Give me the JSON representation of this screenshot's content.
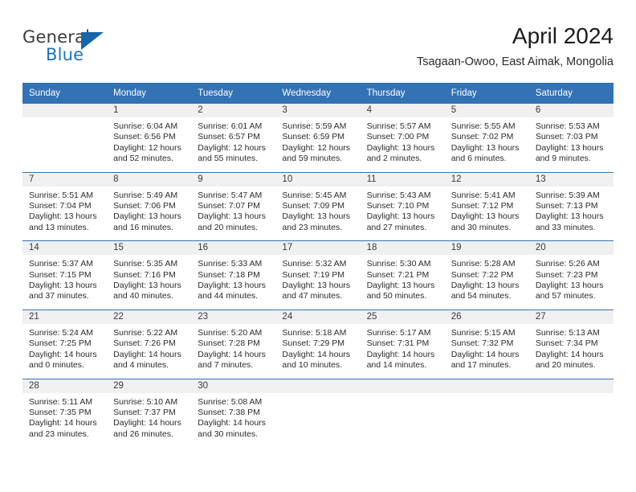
{
  "brand": {
    "name_part1": "General",
    "name_part2": "Blue",
    "logo_icon": "triangle-logo-icon",
    "accent_color": "#1666a8"
  },
  "header": {
    "title": "April 2024",
    "subtitle": "Tsagaan-Owoo, East Aimak, Mongolia"
  },
  "theme": {
    "header_blue": "#3272b5",
    "daynum_bg": "#f0f0f0",
    "separator": "#3272b5"
  },
  "calendar": {
    "weekday_headers": [
      "Sunday",
      "Monday",
      "Tuesday",
      "Wednesday",
      "Thursday",
      "Friday",
      "Saturday"
    ],
    "weeks": [
      [
        {
          "day": "",
          "sunrise": "",
          "sunset": "",
          "daylight1": "",
          "daylight2": ""
        },
        {
          "day": "1",
          "sunrise": "Sunrise: 6:04 AM",
          "sunset": "Sunset: 6:56 PM",
          "daylight1": "Daylight: 12 hours",
          "daylight2": "and 52 minutes."
        },
        {
          "day": "2",
          "sunrise": "Sunrise: 6:01 AM",
          "sunset": "Sunset: 6:57 PM",
          "daylight1": "Daylight: 12 hours",
          "daylight2": "and 55 minutes."
        },
        {
          "day": "3",
          "sunrise": "Sunrise: 5:59 AM",
          "sunset": "Sunset: 6:59 PM",
          "daylight1": "Daylight: 12 hours",
          "daylight2": "and 59 minutes."
        },
        {
          "day": "4",
          "sunrise": "Sunrise: 5:57 AM",
          "sunset": "Sunset: 7:00 PM",
          "daylight1": "Daylight: 13 hours",
          "daylight2": "and 2 minutes."
        },
        {
          "day": "5",
          "sunrise": "Sunrise: 5:55 AM",
          "sunset": "Sunset: 7:02 PM",
          "daylight1": "Daylight: 13 hours",
          "daylight2": "and 6 minutes."
        },
        {
          "day": "6",
          "sunrise": "Sunrise: 5:53 AM",
          "sunset": "Sunset: 7:03 PM",
          "daylight1": "Daylight: 13 hours",
          "daylight2": "and 9 minutes."
        }
      ],
      [
        {
          "day": "7",
          "sunrise": "Sunrise: 5:51 AM",
          "sunset": "Sunset: 7:04 PM",
          "daylight1": "Daylight: 13 hours",
          "daylight2": "and 13 minutes."
        },
        {
          "day": "8",
          "sunrise": "Sunrise: 5:49 AM",
          "sunset": "Sunset: 7:06 PM",
          "daylight1": "Daylight: 13 hours",
          "daylight2": "and 16 minutes."
        },
        {
          "day": "9",
          "sunrise": "Sunrise: 5:47 AM",
          "sunset": "Sunset: 7:07 PM",
          "daylight1": "Daylight: 13 hours",
          "daylight2": "and 20 minutes."
        },
        {
          "day": "10",
          "sunrise": "Sunrise: 5:45 AM",
          "sunset": "Sunset: 7:09 PM",
          "daylight1": "Daylight: 13 hours",
          "daylight2": "and 23 minutes."
        },
        {
          "day": "11",
          "sunrise": "Sunrise: 5:43 AM",
          "sunset": "Sunset: 7:10 PM",
          "daylight1": "Daylight: 13 hours",
          "daylight2": "and 27 minutes."
        },
        {
          "day": "12",
          "sunrise": "Sunrise: 5:41 AM",
          "sunset": "Sunset: 7:12 PM",
          "daylight1": "Daylight: 13 hours",
          "daylight2": "and 30 minutes."
        },
        {
          "day": "13",
          "sunrise": "Sunrise: 5:39 AM",
          "sunset": "Sunset: 7:13 PM",
          "daylight1": "Daylight: 13 hours",
          "daylight2": "and 33 minutes."
        }
      ],
      [
        {
          "day": "14",
          "sunrise": "Sunrise: 5:37 AM",
          "sunset": "Sunset: 7:15 PM",
          "daylight1": "Daylight: 13 hours",
          "daylight2": "and 37 minutes."
        },
        {
          "day": "15",
          "sunrise": "Sunrise: 5:35 AM",
          "sunset": "Sunset: 7:16 PM",
          "daylight1": "Daylight: 13 hours",
          "daylight2": "and 40 minutes."
        },
        {
          "day": "16",
          "sunrise": "Sunrise: 5:33 AM",
          "sunset": "Sunset: 7:18 PM",
          "daylight1": "Daylight: 13 hours",
          "daylight2": "and 44 minutes."
        },
        {
          "day": "17",
          "sunrise": "Sunrise: 5:32 AM",
          "sunset": "Sunset: 7:19 PM",
          "daylight1": "Daylight: 13 hours",
          "daylight2": "and 47 minutes."
        },
        {
          "day": "18",
          "sunrise": "Sunrise: 5:30 AM",
          "sunset": "Sunset: 7:21 PM",
          "daylight1": "Daylight: 13 hours",
          "daylight2": "and 50 minutes."
        },
        {
          "day": "19",
          "sunrise": "Sunrise: 5:28 AM",
          "sunset": "Sunset: 7:22 PM",
          "daylight1": "Daylight: 13 hours",
          "daylight2": "and 54 minutes."
        },
        {
          "day": "20",
          "sunrise": "Sunrise: 5:26 AM",
          "sunset": "Sunset: 7:23 PM",
          "daylight1": "Daylight: 13 hours",
          "daylight2": "and 57 minutes."
        }
      ],
      [
        {
          "day": "21",
          "sunrise": "Sunrise: 5:24 AM",
          "sunset": "Sunset: 7:25 PM",
          "daylight1": "Daylight: 14 hours",
          "daylight2": "and 0 minutes."
        },
        {
          "day": "22",
          "sunrise": "Sunrise: 5:22 AM",
          "sunset": "Sunset: 7:26 PM",
          "daylight1": "Daylight: 14 hours",
          "daylight2": "and 4 minutes."
        },
        {
          "day": "23",
          "sunrise": "Sunrise: 5:20 AM",
          "sunset": "Sunset: 7:28 PM",
          "daylight1": "Daylight: 14 hours",
          "daylight2": "and 7 minutes."
        },
        {
          "day": "24",
          "sunrise": "Sunrise: 5:18 AM",
          "sunset": "Sunset: 7:29 PM",
          "daylight1": "Daylight: 14 hours",
          "daylight2": "and 10 minutes."
        },
        {
          "day": "25",
          "sunrise": "Sunrise: 5:17 AM",
          "sunset": "Sunset: 7:31 PM",
          "daylight1": "Daylight: 14 hours",
          "daylight2": "and 14 minutes."
        },
        {
          "day": "26",
          "sunrise": "Sunrise: 5:15 AM",
          "sunset": "Sunset: 7:32 PM",
          "daylight1": "Daylight: 14 hours",
          "daylight2": "and 17 minutes."
        },
        {
          "day": "27",
          "sunrise": "Sunrise: 5:13 AM",
          "sunset": "Sunset: 7:34 PM",
          "daylight1": "Daylight: 14 hours",
          "daylight2": "and 20 minutes."
        }
      ],
      [
        {
          "day": "28",
          "sunrise": "Sunrise: 5:11 AM",
          "sunset": "Sunset: 7:35 PM",
          "daylight1": "Daylight: 14 hours",
          "daylight2": "and 23 minutes."
        },
        {
          "day": "29",
          "sunrise": "Sunrise: 5:10 AM",
          "sunset": "Sunset: 7:37 PM",
          "daylight1": "Daylight: 14 hours",
          "daylight2": "and 26 minutes."
        },
        {
          "day": "30",
          "sunrise": "Sunrise: 5:08 AM",
          "sunset": "Sunset: 7:38 PM",
          "daylight1": "Daylight: 14 hours",
          "daylight2": "and 30 minutes."
        },
        {
          "day": "",
          "sunrise": "",
          "sunset": "",
          "daylight1": "",
          "daylight2": ""
        },
        {
          "day": "",
          "sunrise": "",
          "sunset": "",
          "daylight1": "",
          "daylight2": ""
        },
        {
          "day": "",
          "sunrise": "",
          "sunset": "",
          "daylight1": "",
          "daylight2": ""
        },
        {
          "day": "",
          "sunrise": "",
          "sunset": "",
          "daylight1": "",
          "daylight2": ""
        }
      ]
    ]
  }
}
